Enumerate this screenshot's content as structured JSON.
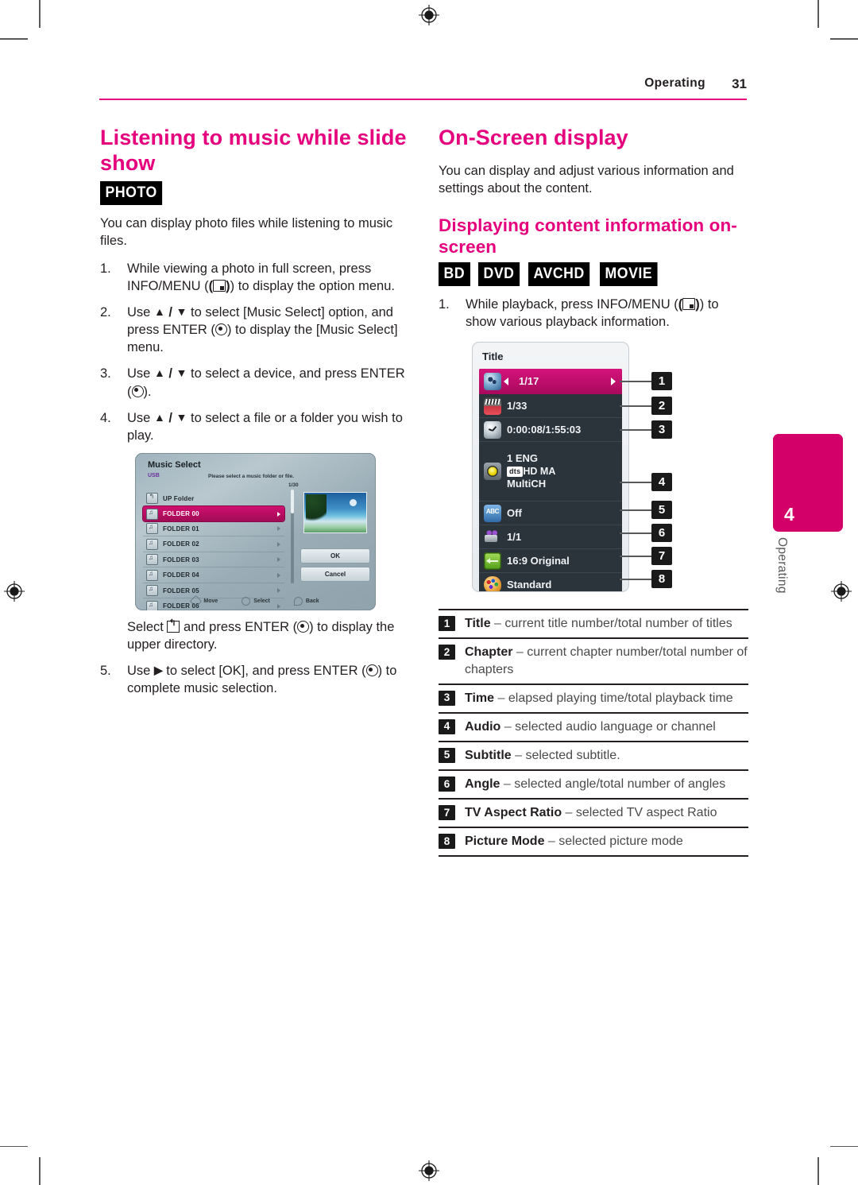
{
  "header": {
    "chapter": "Operating",
    "page_number": "31"
  },
  "side_tab": {
    "number": "4",
    "label": "Operating"
  },
  "left_column": {
    "section_title": "Listening to music while slide show",
    "badges": [
      "PHOTO"
    ],
    "intro": "You can display photo files while listening to music files.",
    "steps": [
      {
        "num": "1.",
        "parts": [
          "While viewing a photo in full screen, press INFO/MENU (",
          ") to display the option menu."
        ]
      },
      {
        "num": "2.",
        "parts": [
          "Use ",
          "▲",
          " / ",
          "▼",
          " to select [Music Select] option, and press ENTER (",
          ") to display the [Music Select] menu."
        ]
      },
      {
        "num": "3.",
        "parts": [
          "Use ",
          "▲",
          " / ",
          "▼",
          " to select a device, and press ENTER (",
          ")."
        ]
      },
      {
        "num": "4.",
        "parts": [
          "Use ",
          "▲",
          " / ",
          "▼",
          " to select a file or a folder you wish to play."
        ]
      }
    ],
    "after_figure_note": {
      "parts": [
        "Select ",
        " and press ENTER (",
        ") to display the upper directory."
      ]
    },
    "step5": {
      "num": "5.",
      "parts": [
        "Use ",
        "▶",
        " to select [OK], and press ENTER (",
        ") to complete music selection."
      ]
    },
    "music_select_figure": {
      "title": "Music Select",
      "source": "USB",
      "hint": "Please select a music folder or file.",
      "count": "1/30",
      "items": [
        {
          "name": "UP Folder",
          "icon": "up-folder-icon",
          "selected": false
        },
        {
          "name": "FOLDER 00",
          "icon": "music-folder-icon",
          "selected": true
        },
        {
          "name": "FOLDER 01",
          "icon": "music-folder-icon",
          "selected": false
        },
        {
          "name": "FOLDER 02",
          "icon": "music-folder-icon",
          "selected": false
        },
        {
          "name": "FOLDER 03",
          "icon": "music-folder-icon",
          "selected": false
        },
        {
          "name": "FOLDER 04",
          "icon": "music-folder-icon",
          "selected": false
        },
        {
          "name": "FOLDER 05",
          "icon": "music-folder-icon",
          "selected": false
        },
        {
          "name": "FOLDER 06",
          "icon": "music-folder-icon",
          "selected": false
        }
      ],
      "ok_label": "OK",
      "cancel_label": "Cancel",
      "footer": [
        "Move",
        "Select",
        "Back"
      ]
    }
  },
  "right_column": {
    "section_title": "On-Screen display",
    "intro": "You can display and adjust various information and settings about the content.",
    "sub_title": "Displaying content information on-screen",
    "badges": [
      "BD",
      "DVD",
      "AVCHD",
      "MOVIE"
    ],
    "step1": {
      "num": "1.",
      "parts": [
        "While playback, press INFO/MENU (",
        ") to show various playback information."
      ]
    },
    "osd_figure": {
      "title": "Title",
      "rows": [
        {
          "callout": "1",
          "icon": "title-disc-icon",
          "value": "1/17",
          "selected": true
        },
        {
          "callout": "2",
          "icon": "chapter-clapperboard-icon",
          "value": "1/33",
          "selected": false
        },
        {
          "callout": "3",
          "icon": "time-clock-icon",
          "value": "0:00:08/1:55:03",
          "selected": false
        },
        {
          "callout": "4",
          "icon": "audio-speaker-icon",
          "value": "1 ENG",
          "value2": "dts",
          "value2b": "HD MA",
          "value3": "MultiCH",
          "selected": false
        },
        {
          "callout": "5",
          "icon": "subtitle-abc-icon",
          "value": "Off",
          "selected": false
        },
        {
          "callout": "6",
          "icon": "angle-camera-icon",
          "value": "1/1",
          "selected": false
        },
        {
          "callout": "7",
          "icon": "aspect-ratio-icon",
          "value": "16:9 Original",
          "selected": false
        },
        {
          "callout": "8",
          "icon": "picture-mode-palette-icon",
          "value": "Standard",
          "selected": false
        }
      ]
    },
    "legend": [
      {
        "num": "1",
        "term": "Title",
        "dash": " – ",
        "desc": "current title number/total number of titles"
      },
      {
        "num": "2",
        "term": "Chapter",
        "dash": " – ",
        "desc": "current chapter number/total number of chapters"
      },
      {
        "num": "3",
        "term": "Time",
        "dash": " – ",
        "desc": "elapsed playing time/total playback time"
      },
      {
        "num": "4",
        "term": "Audio",
        "dash": " – ",
        "desc": "selected audio language or channel"
      },
      {
        "num": "5",
        "term": "Subtitle",
        "dash": " – ",
        "desc": "selected subtitle."
      },
      {
        "num": "6",
        "term": "Angle",
        "dash": " – ",
        "desc": "selected angle/total number of angles"
      },
      {
        "num": "7",
        "term": "TV Aspect Ratio",
        "dash": " – ",
        "desc": "selected TV aspect Ratio"
      },
      {
        "num": "8",
        "term": "Picture Mode",
        "dash": " – ",
        "desc": "selected picture mode"
      }
    ]
  },
  "colors": {
    "accent_magenta": "#e5007d",
    "tab_magenta": "#d4006a",
    "osd_dark": "#2b333b",
    "text": "#231f20"
  }
}
